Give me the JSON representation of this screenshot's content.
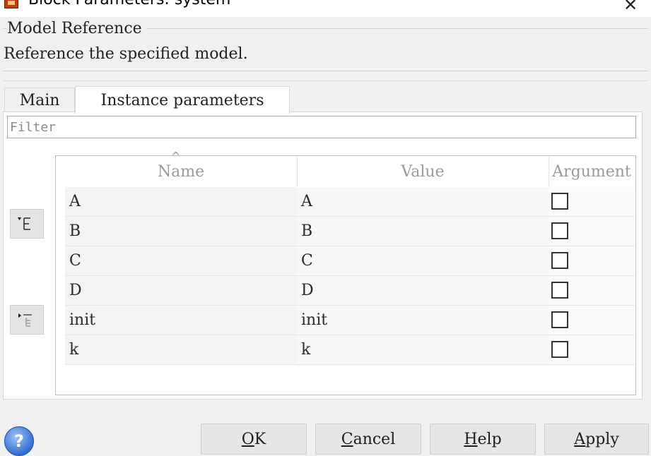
{
  "window": {
    "title": "Block Parameters: system",
    "close_glyph": "✕"
  },
  "header": {
    "group_label": "Model Reference",
    "description": "Reference the specified model."
  },
  "tabs": [
    {
      "label": "Main",
      "active": false
    },
    {
      "label": "Instance parameters",
      "active": true
    }
  ],
  "filter": {
    "placeholder": "Filter",
    "value": ""
  },
  "side_buttons": [
    {
      "icon": "promote-parameter-icon"
    },
    {
      "icon": "demote-parameter-icon"
    }
  ],
  "table": {
    "columns": [
      "Name",
      "Value",
      "Argument"
    ],
    "sort_glyph": "^",
    "rows": [
      {
        "name": "A",
        "value": "A",
        "argument": false
      },
      {
        "name": "B",
        "value": "B",
        "argument": false
      },
      {
        "name": "C",
        "value": "C",
        "argument": false
      },
      {
        "name": "D",
        "value": "D",
        "argument": false
      },
      {
        "name": "init",
        "value": "init",
        "argument": false
      },
      {
        "name": "k",
        "value": "k",
        "argument": false
      }
    ]
  },
  "footer": {
    "help_glyph": "?",
    "buttons": [
      {
        "mnemonic": "O",
        "rest": "K"
      },
      {
        "mnemonic": "C",
        "rest": "ancel"
      },
      {
        "mnemonic": "H",
        "rest": "elp"
      },
      {
        "mnemonic": "A",
        "rest": "pply"
      }
    ]
  },
  "colors": {
    "window_bg": "#f0f0f0",
    "panel_bg": "#ffffff",
    "row_bg": "#f3f3f3",
    "header_text": "#9a9a9a",
    "help_blue": "#2f6fd4"
  }
}
